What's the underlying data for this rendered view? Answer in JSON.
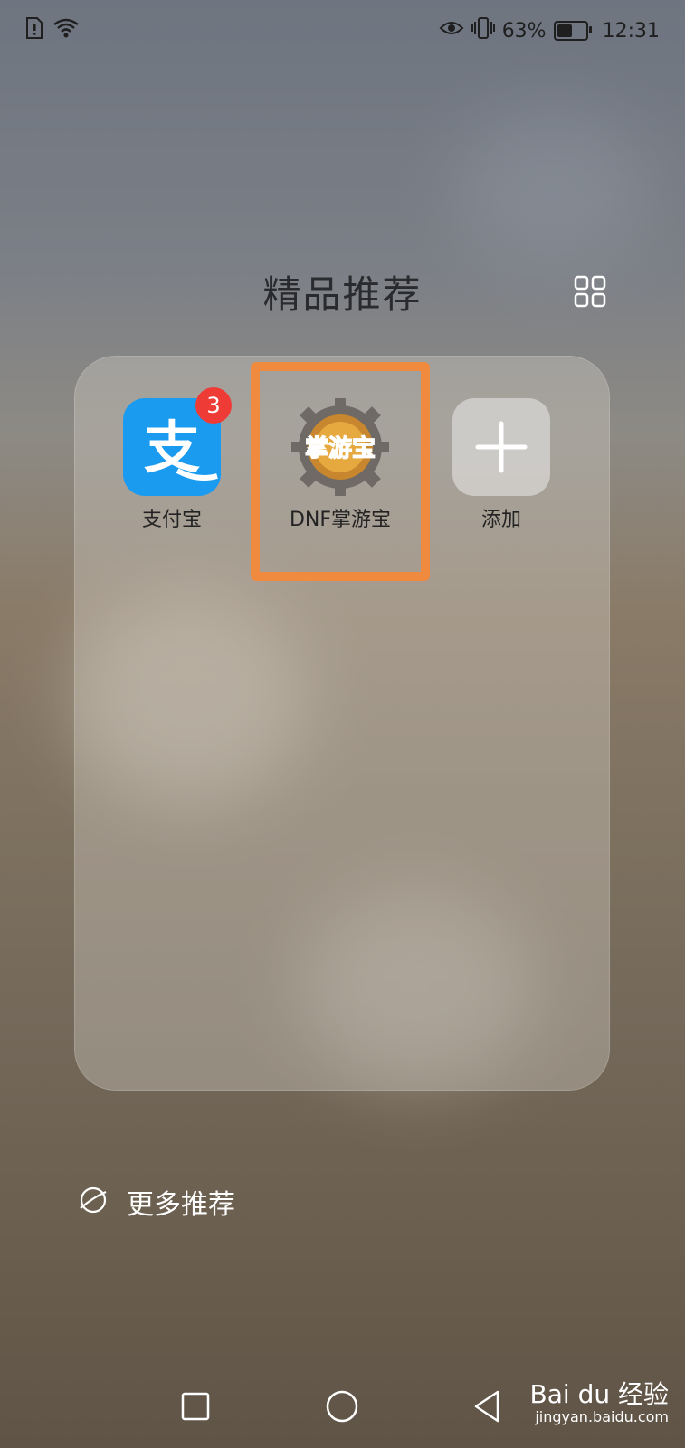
{
  "status_bar": {
    "battery_percent": "63%",
    "battery_level": 0.63,
    "time": "12:31",
    "icons_left": [
      "sim-alert-icon",
      "wifi-icon"
    ],
    "icons_right": [
      "eye-icon",
      "vibrate-icon",
      "battery-icon"
    ]
  },
  "folder": {
    "title": "精品推荐",
    "apps": [
      {
        "label": "支付宝",
        "badge": "3",
        "icon": "alipay-icon",
        "color": "#1a9bf0"
      },
      {
        "label": "DNF掌游宝",
        "icon": "dnf-zhangyoubao-icon",
        "icon_text": "掌游宝"
      },
      {
        "label": "添加",
        "icon": "plus-icon"
      }
    ]
  },
  "more": {
    "label": "更多推荐"
  },
  "watermark": {
    "brand": "Bai du 经验",
    "url": "jingyan.baidu.com"
  },
  "colors": {
    "highlight": "#ef8a3e",
    "badge": "#ef3b36",
    "alipay": "#1a9bf0"
  }
}
